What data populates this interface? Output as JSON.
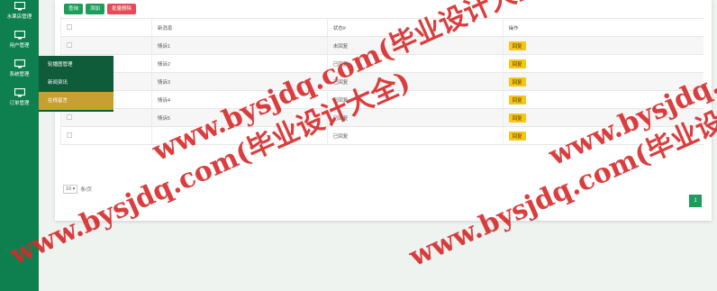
{
  "sidebar": {
    "items": [
      {
        "label": "水果店管理"
      },
      {
        "label": "用户管理"
      },
      {
        "label": "系统管理"
      },
      {
        "label": "订单管理"
      }
    ],
    "flyout": [
      {
        "label": "轮播图管理"
      },
      {
        "label": "新闻资讯"
      },
      {
        "label": "在线留言"
      }
    ]
  },
  "toolbar": {
    "search": "查询",
    "add": "添加",
    "batch_delete": "批量删除"
  },
  "table": {
    "headers": [
      "新消息",
      "状态#",
      "操作"
    ],
    "rows": [
      {
        "msg": "情诉1",
        "status": "未回复",
        "action": "回复"
      },
      {
        "msg": "情诉2",
        "status": "已回复",
        "action": "回复"
      },
      {
        "msg": "情诉3",
        "status": "已回复",
        "action": "回复"
      },
      {
        "msg": "情诉4",
        "status": "已回复",
        "action": "回复"
      },
      {
        "msg": "情诉5",
        "status": "已回复",
        "action": "回复"
      },
      {
        "msg": "",
        "status": "已回复",
        "action": "回复"
      }
    ]
  },
  "pager": {
    "page_size": "10",
    "suffix": "条/页",
    "current": "1"
  },
  "watermark": {
    "text": "www.bysjdq.com(毕业设计大全)"
  },
  "colors": {
    "sidebar": "#0e7f4f",
    "accent": "#1e9e5a",
    "danger": "#e84a57",
    "reply": "#f5c518",
    "flyout_active": "#c8a032"
  }
}
